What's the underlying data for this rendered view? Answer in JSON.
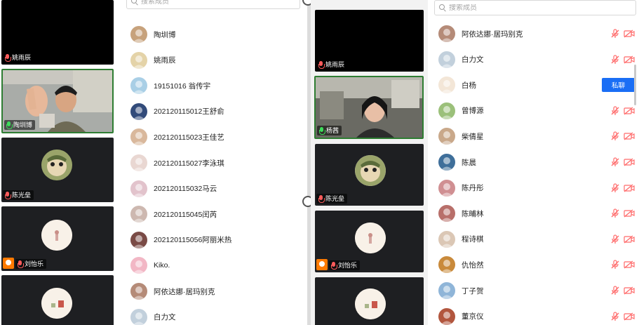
{
  "left_pane": {
    "videos": [
      {
        "name": "姚雨辰"
      },
      {
        "name": "陶圳博"
      },
      {
        "name": "陈光垒"
      },
      {
        "name": "刘怡乐"
      }
    ],
    "search_placeholder": "搜索成员",
    "members": [
      {
        "name": "陶圳博"
      },
      {
        "name": "姚雨辰"
      },
      {
        "name": "19151016 翁传宇"
      },
      {
        "name": "202120115012王舒俞"
      },
      {
        "name": "202120115023王佳艺"
      },
      {
        "name": "202120115027李泳琪"
      },
      {
        "name": "202120115032马云"
      },
      {
        "name": "202120115045闰芮"
      },
      {
        "name": "202120115056阿丽米热"
      },
      {
        "name": "Kiko."
      },
      {
        "name": "阿依达娜·居玛别克"
      },
      {
        "name": "白力文"
      }
    ]
  },
  "right_pane": {
    "videos": [
      {
        "name": "姚雨辰"
      },
      {
        "name": "杨茜"
      },
      {
        "name": "陈光垒"
      },
      {
        "name": "刘怡乐"
      }
    ],
    "search_placeholder": "搜索成员",
    "private_chat_label": "私聊",
    "members": [
      {
        "name": "阿依达娜·居玛别克"
      },
      {
        "name": "白力文"
      },
      {
        "name": "白杨"
      },
      {
        "name": "曾博源"
      },
      {
        "name": "柴倩星"
      },
      {
        "name": "陈晨"
      },
      {
        "name": "陈丹彤"
      },
      {
        "name": "陈晡林"
      },
      {
        "name": "程诗棋"
      },
      {
        "name": "仇怡然"
      },
      {
        "name": "丁子贺"
      },
      {
        "name": "董京仪"
      }
    ]
  },
  "colors": {
    "accent": "#1a6ef5",
    "muted_icon": "#ff6b6b",
    "active_speaker_border": "#2e7d32",
    "camera_badge": "#ff7a00"
  }
}
